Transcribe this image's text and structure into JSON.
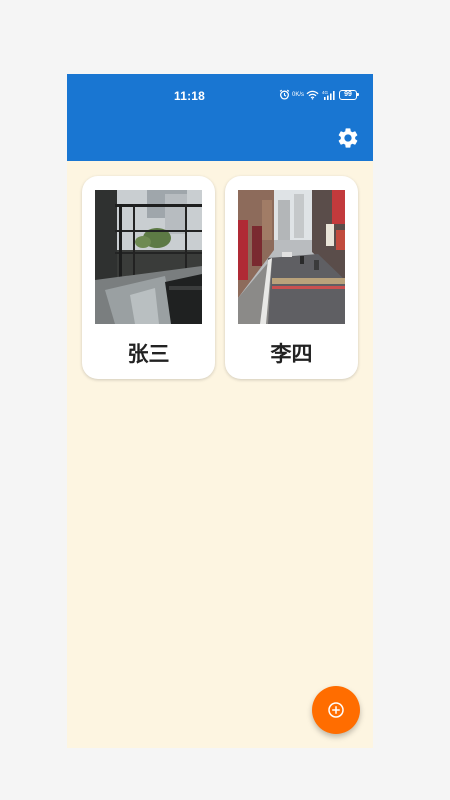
{
  "status_bar": {
    "time": "11:18",
    "net_speed_top": "0",
    "net_speed_bottom": "K/s",
    "network_label": "4G",
    "battery": "99"
  },
  "app_bar": {
    "settings_icon": "gear-icon"
  },
  "contacts": [
    {
      "name": "张三",
      "photo": "balcony-railing-photo"
    },
    {
      "name": "李四",
      "photo": "city-street-photo"
    }
  ],
  "fab": {
    "icon": "add-circle-icon"
  },
  "colors": {
    "app_bar": "#1976d2",
    "background": "#fdf5e1",
    "card": "#ffffff",
    "fab": "#ff6d00",
    "text": "#222222"
  }
}
